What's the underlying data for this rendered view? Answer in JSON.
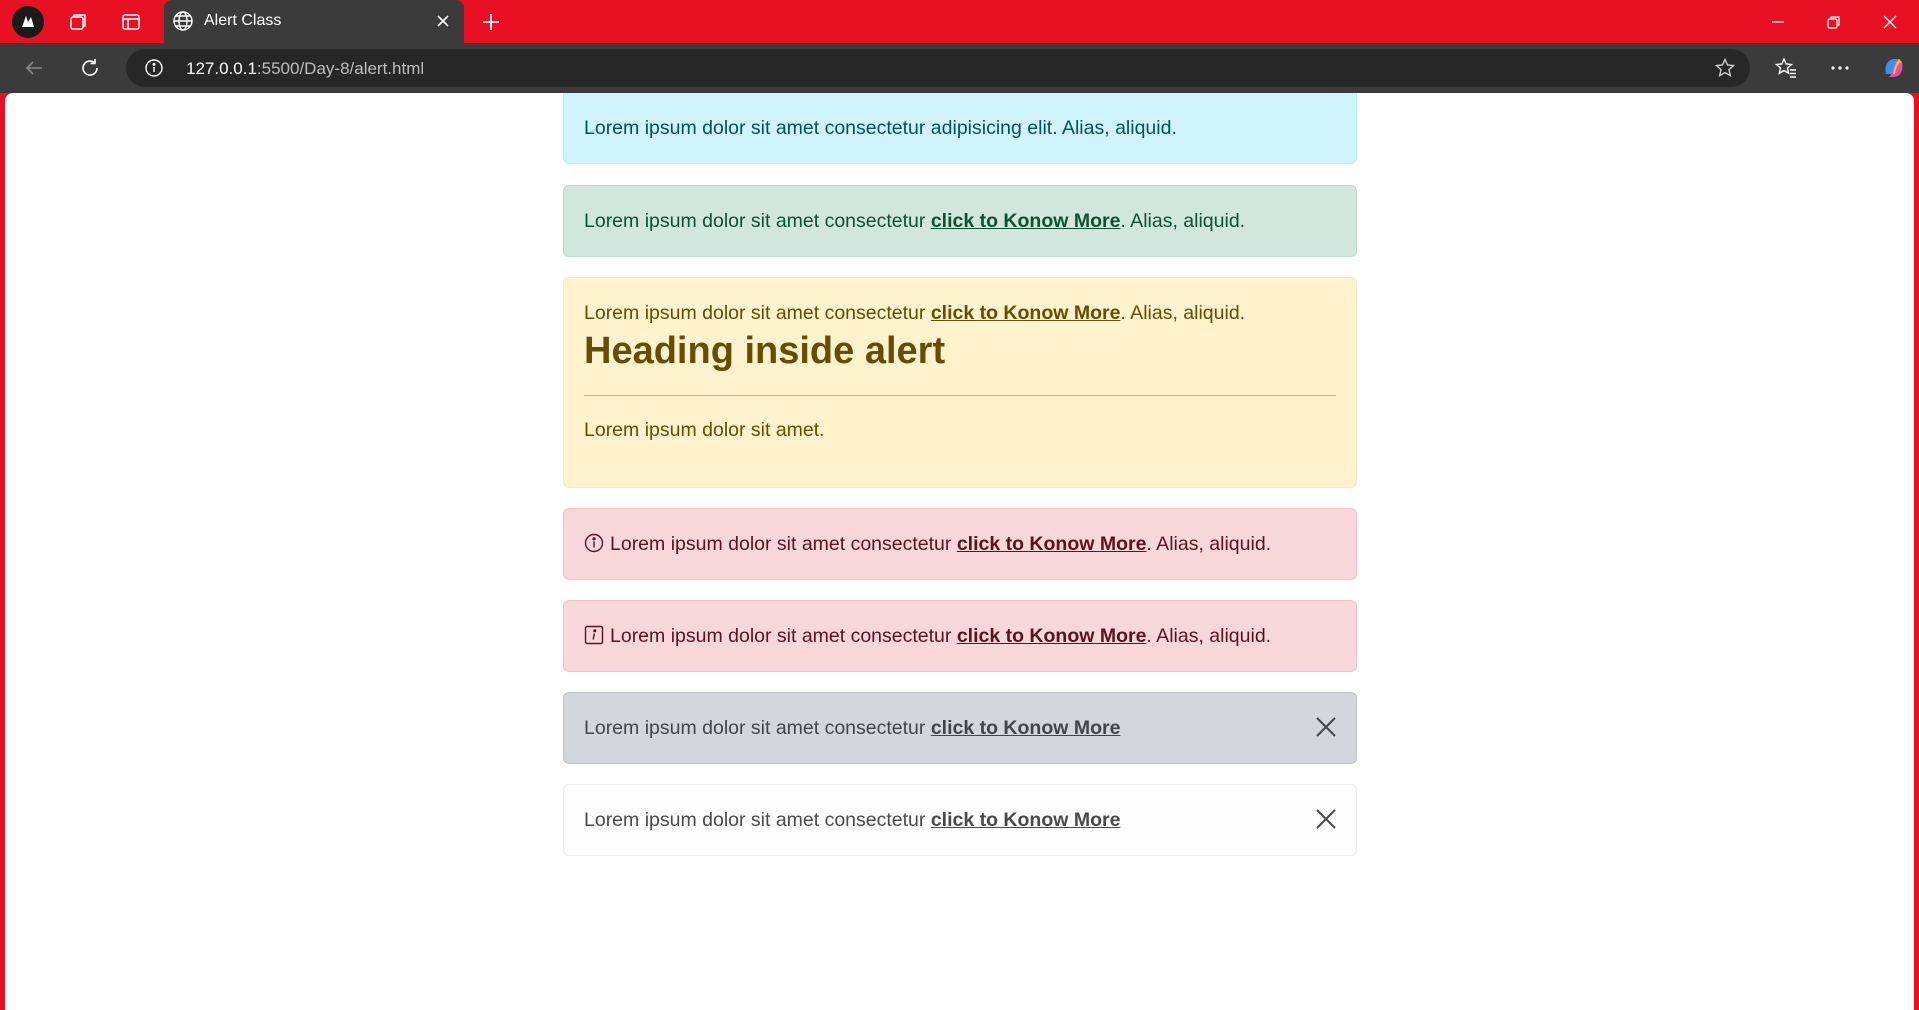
{
  "browser": {
    "tab_title": "Alert Class",
    "url_host": "127.0.0.1",
    "url_rest": ":5500/Day-8/alert.html"
  },
  "alerts": {
    "info": {
      "text": "Lorem ipsum dolor sit amet consectetur adipisicing elit. Alias, aliquid."
    },
    "success": {
      "text_before": "Lorem ipsum dolor sit amet consectetur ",
      "link": "click to Konow More",
      "text_after": ". Alias, aliquid."
    },
    "warning": {
      "text_before": "Lorem ipsum dolor sit amet consectetur ",
      "link": "click to Konow More",
      "text_after": ". Alias, aliquid.",
      "heading": "Heading inside alert",
      "body": "Lorem ipsum dolor sit amet."
    },
    "danger1": {
      "text_before": "Lorem ipsum dolor sit amet consectetur ",
      "link": "click to Konow More",
      "text_after": ". Alias, aliquid.",
      "icon": "info-circle-icon"
    },
    "danger2": {
      "text_before": "Lorem ipsum dolor sit amet consectetur ",
      "link": "click to Konow More",
      "text_after": ". Alias, aliquid.",
      "icon": "info-square-icon"
    },
    "secondary": {
      "text_before": "Lorem ipsum dolor sit amet consectetur ",
      "link": "click to Konow More"
    },
    "light": {
      "text_before": "Lorem ipsum dolor sit amet consectetur ",
      "link": "click to Konow More"
    }
  },
  "colors": {
    "titlebar": "#e81123",
    "info_bg": "#cff4fc",
    "success_bg": "#d1e7dd",
    "warning_bg": "#fff3cd",
    "danger_bg": "#f8d7da",
    "secondary_bg": "#d3d6dc",
    "light_bg": "#fefefe"
  }
}
